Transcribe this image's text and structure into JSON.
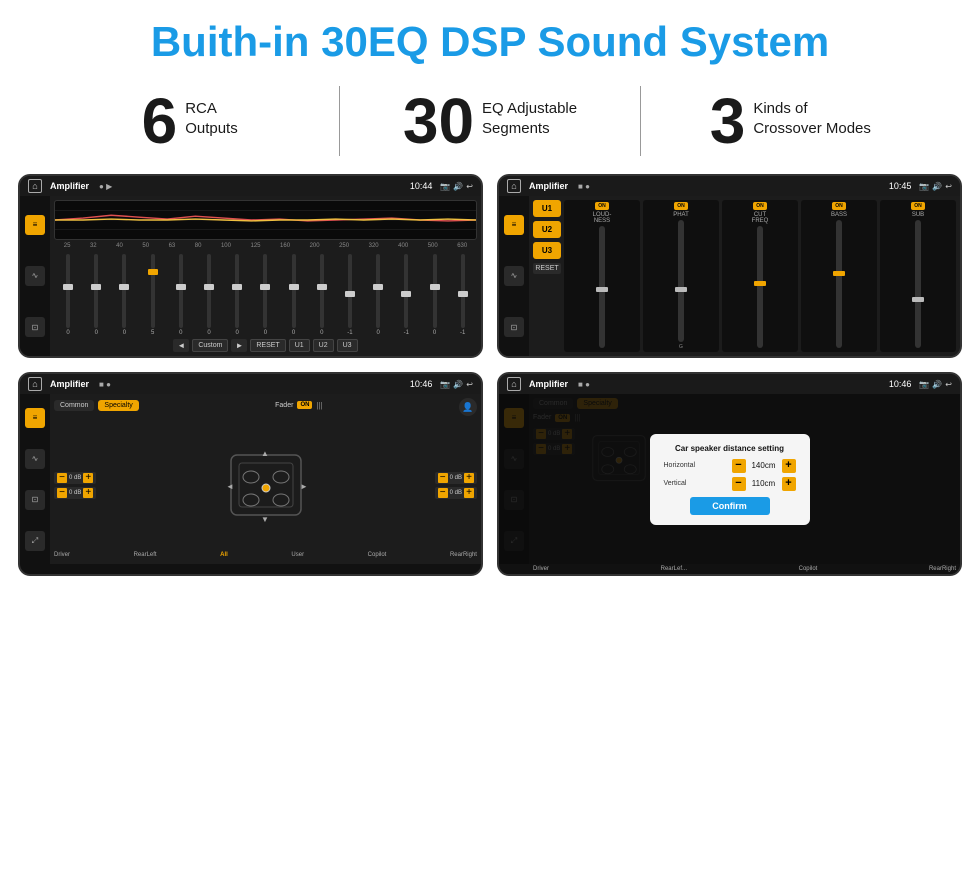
{
  "header": {
    "title": "Buith-in 30EQ DSP Sound System"
  },
  "stats": [
    {
      "number": "6",
      "line1": "RCA",
      "line2": "Outputs"
    },
    {
      "number": "30",
      "line1": "EQ Adjustable",
      "line2": "Segments"
    },
    {
      "number": "3",
      "line1": "Kinds of",
      "line2": "Crossover Modes"
    }
  ],
  "screens": [
    {
      "id": "eq-screen",
      "appName": "Amplifier",
      "time": "10:44",
      "type": "equalizer",
      "freqs": [
        "25",
        "32",
        "40",
        "50",
        "63",
        "80",
        "100",
        "125",
        "160",
        "200",
        "250",
        "320",
        "400",
        "500",
        "630"
      ],
      "values": [
        "0",
        "0",
        "0",
        "5",
        "0",
        "0",
        "0",
        "0",
        "0",
        "0",
        "-1",
        "0",
        "-1"
      ],
      "bottomBtns": [
        "◄",
        "Custom",
        "►",
        "RESET",
        "U1",
        "U2",
        "U3"
      ]
    },
    {
      "id": "mixer-screen",
      "appName": "Amplifier",
      "time": "10:45",
      "type": "mixer",
      "channels": [
        "LOUDNESS",
        "PHAT",
        "CUT FREQ",
        "BASS",
        "SUB"
      ],
      "uButtons": [
        "U1",
        "U2",
        "U3"
      ],
      "resetLabel": "RESET"
    },
    {
      "id": "crossover-screen",
      "appName": "Amplifier",
      "time": "10:46",
      "type": "crossover",
      "tabs": [
        "Common",
        "Specialty"
      ],
      "faderLabel": "Fader",
      "onLabel": "ON",
      "driverLabel": "Driver",
      "copilotLabel": "Copilot",
      "rearLeftLabel": "RearLeft",
      "allLabel": "All",
      "userLabel": "User",
      "rearRightLabel": "RearRight",
      "dbValues": [
        "0 dB",
        "0 dB",
        "0 dB",
        "0 dB"
      ]
    },
    {
      "id": "dialog-screen",
      "appName": "Amplifier",
      "time": "10:46",
      "type": "dialog",
      "tabs": [
        "Common",
        "Specialty"
      ],
      "dialogTitle": "Car speaker distance setting",
      "horizontal": {
        "label": "Horizontal",
        "value": "140cm"
      },
      "vertical": {
        "label": "Vertical",
        "value": "110cm"
      },
      "confirmLabel": "Confirm",
      "driverLabel": "Driver",
      "copilotLabel": "Copilot",
      "rearLeftLabel": "RearLef...",
      "rearRightLabel": "RearRight",
      "dbValues": [
        "0 dB",
        "0 dB"
      ]
    }
  ],
  "colors": {
    "accent": "#1a9be6",
    "gold": "#f0a500",
    "dark": "#1c1c1c",
    "text": "#ffffff"
  }
}
